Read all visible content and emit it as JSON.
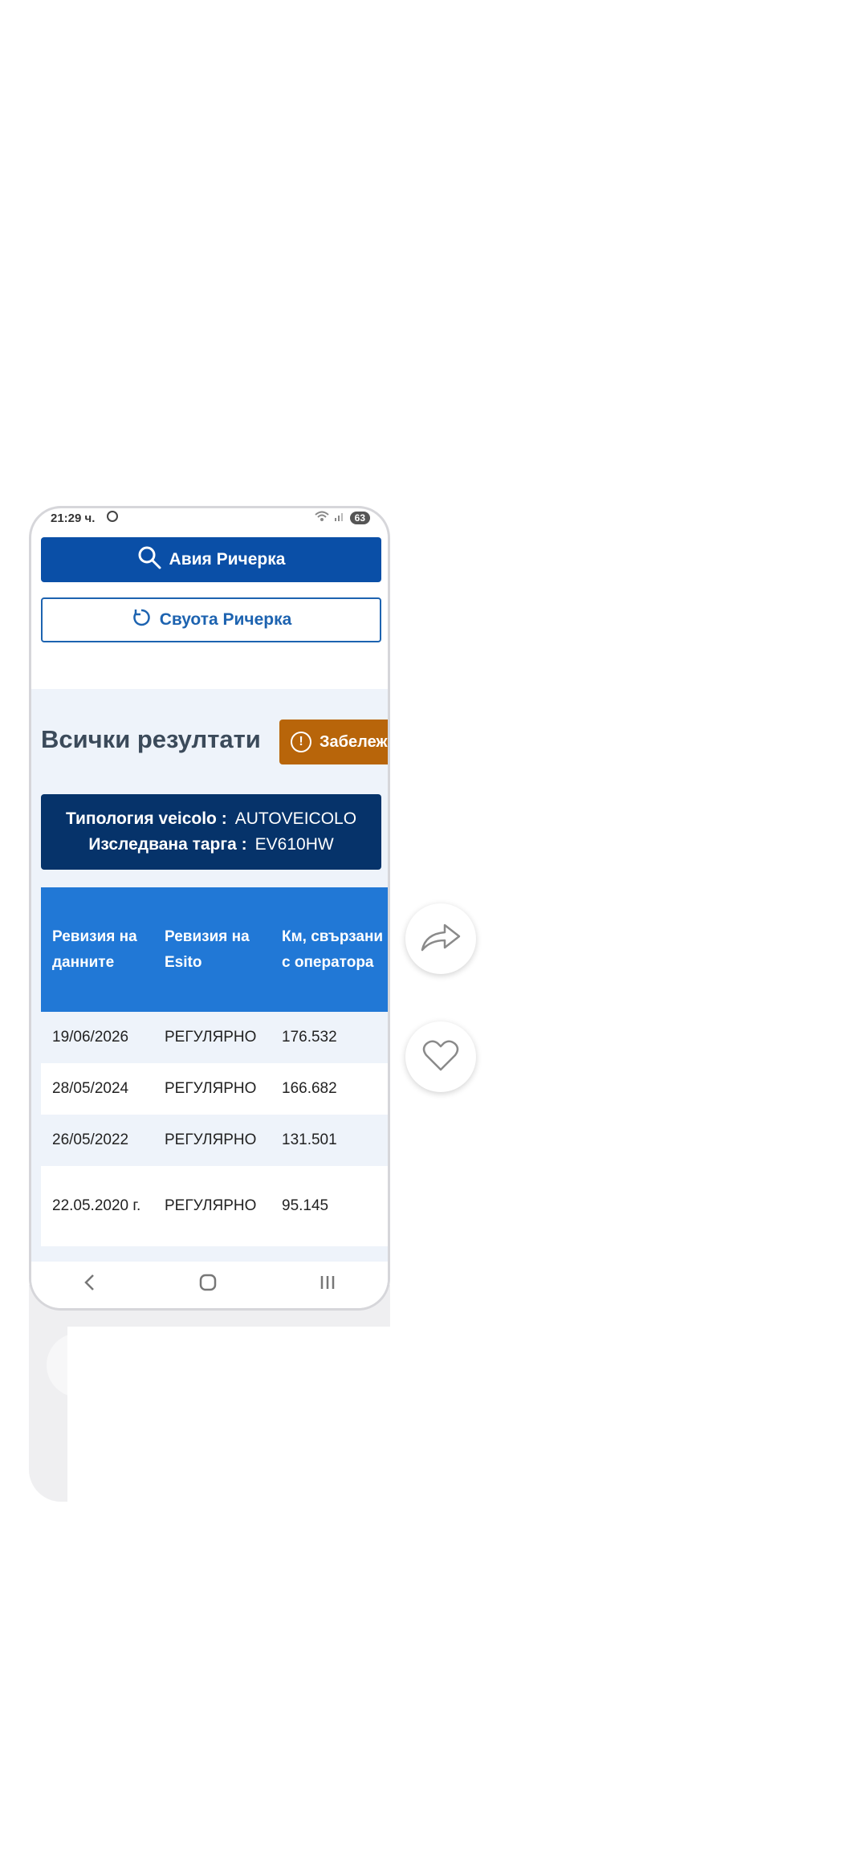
{
  "status_bar": {
    "time": "21:29 ч.",
    "battery": "63"
  },
  "search_button": {
    "label": "Авия Ричерка",
    "icon": "search-icon"
  },
  "reset_button": {
    "label": "Свуота Ричерка",
    "icon": "refresh-icon"
  },
  "results": {
    "title": "Всички резултати",
    "notice_button": {
      "label": "Забележ",
      "icon": "exclamation-icon"
    }
  },
  "vehicle_info": {
    "type_label": "Типология veicolo :",
    "type_value": "AUTOVEICOLO",
    "plate_label": "Изследвана тарга :",
    "plate_value": "EV610HW"
  },
  "table": {
    "headers": [
      "Ревизия на данните",
      "Ревизия на Esito",
      "Км, свързани с оператора"
    ],
    "rows": [
      [
        "19/06/2026",
        "РЕГУЛЯРНО",
        "176.532"
      ],
      [
        "28/05/2024",
        "РЕГУЛЯРНО",
        "166.682"
      ],
      [
        "26/05/2022",
        "РЕГУЛЯРНО",
        "131.501"
      ],
      [
        "22.05.2020 г.",
        "РЕГУЛЯРНО",
        "95.145"
      ]
    ]
  },
  "nav": [
    "back-icon",
    "home-icon",
    "recents-icon"
  ],
  "side_actions": [
    "share-icon",
    "heart-icon"
  ],
  "colors": {
    "primary": "#0a4fa7",
    "outline": "#1d63b0",
    "warning": "#b8650a",
    "info_bg": "#06336a",
    "table_header": "#2178d6"
  }
}
